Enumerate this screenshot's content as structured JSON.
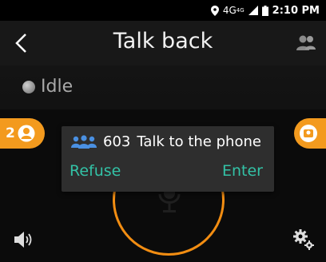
{
  "status_bar": {
    "network": "4G",
    "network_sup": "4G",
    "time": "2:10 PM"
  },
  "header": {
    "title": "Talk back"
  },
  "state": {
    "label": "Idle"
  },
  "left_badge": {
    "count": "2"
  },
  "dialog": {
    "group_id": "603",
    "message": "Talk to the phone",
    "refuse_label": "Refuse",
    "enter_label": "Enter"
  },
  "colors": {
    "accent": "#f39a1e",
    "action": "#33c2a6"
  }
}
